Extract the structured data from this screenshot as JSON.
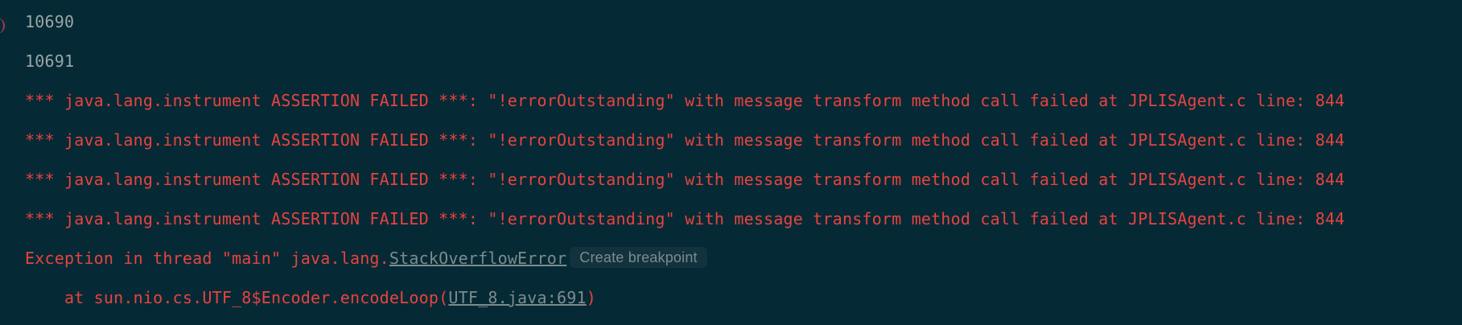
{
  "console": {
    "lines": [
      {
        "text": "10690"
      },
      {
        "text": "10691"
      },
      {
        "text": "*** java.lang.instrument ASSERTION FAILED ***: \"!errorOutstanding\" with message transform method call failed at JPLISAgent.c line: 844"
      },
      {
        "text": "*** java.lang.instrument ASSERTION FAILED ***: \"!errorOutstanding\" with message transform method call failed at JPLISAgent.c line: 844"
      },
      {
        "text": "*** java.lang.instrument ASSERTION FAILED ***: \"!errorOutstanding\" with message transform method call failed at JPLISAgent.c line: 844"
      },
      {
        "text": "*** java.lang.instrument ASSERTION FAILED ***: \"!errorOutstanding\" with message transform method call failed at JPLISAgent.c line: 844"
      }
    ],
    "exception": {
      "prefix": "Exception in thread \"main\" java.lang.",
      "class_link": "StackOverflowError",
      "hint": "Create breakpoint"
    },
    "stack": {
      "prefix": "    at sun.nio.cs.UTF_8$Encoder.encodeLoop(",
      "link": "UTF_8.java:691",
      "suffix": ")"
    }
  },
  "colors": {
    "background": "#052a35",
    "normal_text": "#9aa5a6",
    "error_text": "#e8423f",
    "link_text": "#7d8b8d"
  }
}
